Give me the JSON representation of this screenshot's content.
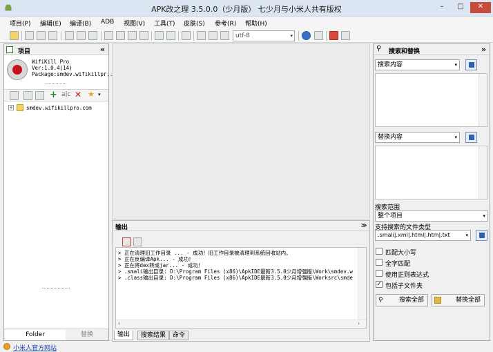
{
  "window": {
    "title": "APK改之理 3.5.0.0（少月版） 七少月与小米人共有版权",
    "controls": [
      "–",
      "□",
      "✕"
    ]
  },
  "menu": [
    "项目(P)",
    "编辑(E)",
    "编译(B)",
    "ADB",
    "视图(V)",
    "工具(T)",
    "皮肤(S)",
    "参考(R)",
    "帮助(H)"
  ],
  "toolbar": {
    "encoding": "utf-8"
  },
  "project": {
    "header": "项目",
    "collapse": "«",
    "app_name": "WifiKill Pro",
    "version": "Ver:1.0.4(14)",
    "package": "Package:smdev.wifikillpr...",
    "tree_item": "smdev.wifikillpro.com",
    "tabs": [
      "Folder",
      "替换"
    ]
  },
  "output": {
    "header": "输出",
    "lines": [
      "> 正在清理旧工作目录 ... - 成功！旧工作目录被清理到系统回收站内。",
      "> 正在反编译Apk... - 成功！",
      "> 正在将dex转成jar... - 成功！",
      "> .smali输出目录: D:\\Program Files (x86)\\ApkIDE最新3.5.0少月增强版\\Work\\smdev.w",
      "> .class输出目录: D:\\Program Files (x86)\\ApkIDE最新3.5.0少月增强版\\Worksrc\\smde"
    ],
    "tabs": [
      "输出",
      "搜索结果",
      "命令"
    ]
  },
  "search": {
    "header": "搜索和替换",
    "collapse": "»",
    "search_label": "搜索内容",
    "replace_label": "替换内容",
    "scope_label": "搜索范围",
    "scope_value": "整个项目",
    "filetypes_label": "支持搜索的文件类型",
    "filetypes_value": ".smali|.xml|.html|.htm|.txt",
    "options": [
      {
        "label": "匹配大小写",
        "checked": false
      },
      {
        "label": "全字匹配",
        "checked": false
      },
      {
        "label": "使用正则表达式",
        "checked": false
      },
      {
        "label": "包括子文件夹",
        "checked": true
      }
    ],
    "search_all": "搜索全部",
    "replace_all": "替换全部"
  },
  "status": {
    "link": "小米人官方网站"
  }
}
